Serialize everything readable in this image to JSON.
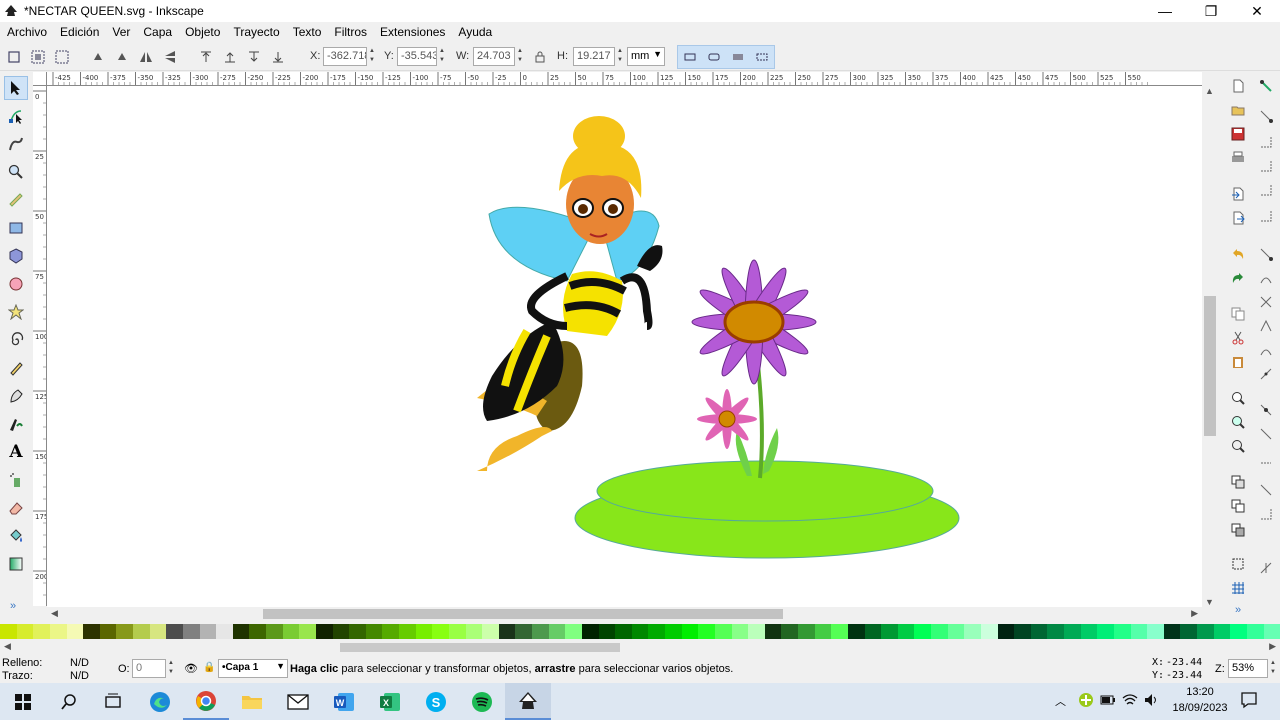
{
  "window": {
    "title": "*NECTAR QUEEN.svg - Inkscape"
  },
  "menu": [
    "Archivo",
    "Edición",
    "Ver",
    "Capa",
    "Objeto",
    "Trayecto",
    "Texto",
    "Filtros",
    "Extensiones",
    "Ayuda"
  ],
  "toolcontrols": {
    "x_label": "X:",
    "x_value": "-362.718",
    "y_label": "Y:",
    "y_value": "-35.543",
    "w_label": "W:",
    "w_value": "24.703",
    "h_label": "H:",
    "h_value": "19.217",
    "unit": "mm"
  },
  "ruler_top_ticks": [
    "-425",
    "-400",
    "-375",
    "-350",
    "-325",
    "-300",
    "-275",
    "-250",
    "-225",
    "-200",
    "-175",
    "-150",
    "-125",
    "-100",
    "-75",
    "-50",
    "-25",
    "0",
    "25",
    "50",
    "75",
    "100",
    "125",
    "150",
    "175",
    "200",
    "225",
    "250",
    "275",
    "300",
    "325",
    "350",
    "375",
    "400",
    "425",
    "450",
    "475",
    "500",
    "525",
    "550"
  ],
  "ruler_left_ticks": [
    "0",
    "25",
    "50",
    "75",
    "100",
    "125",
    "150",
    "175",
    "200"
  ],
  "status": {
    "fill_label": "Relleno:",
    "fill_value": "N/D",
    "stroke_label": "Trazo:",
    "stroke_value": "N/D",
    "opacity_label": "O:",
    "opacity_value": "0",
    "layer": "•Capa 1",
    "msg_bold1": "Haga clic",
    "msg1": " para seleccionar y transformar objetos, ",
    "msg_bold2": "arrastre",
    "msg2": " para seleccionar varios objetos.",
    "cursor_x_label": "X:",
    "cursor_x": "-23.44",
    "cursor_y_label": "Y:",
    "cursor_y": "-23.44",
    "zoom_label": "Z:",
    "zoom": "53%"
  },
  "taskbar": {
    "time": "13:20",
    "date": "18/09/2023"
  },
  "icons": {
    "tools": [
      "selector-icon",
      "node-icon",
      "tweak-icon",
      "zoom-icon",
      "measure-icon",
      "rect-icon",
      "3dbox-icon",
      "ellipse-icon",
      "star-icon",
      "spiral-icon",
      "pencil-icon",
      "pen-icon",
      "calligraphy-icon",
      "text-icon",
      "spray-icon",
      "eraser-icon",
      "bucket-icon",
      "gradient-icon"
    ]
  },
  "palette": [
    "#c9e600",
    "#d7ec2d",
    "#e1f15a",
    "#ebf687",
    "#f5fab4",
    "#2d3300",
    "#5a6600",
    "#87991a",
    "#b4cc4d",
    "#d7e680",
    "#4d4d4d",
    "#808080",
    "#b3b3b3",
    "#e6e6e6",
    "#1f3300",
    "#3d6600",
    "#5c991a",
    "#7acc33",
    "#99e64d",
    "#112200",
    "#224400",
    "#336600",
    "#448800",
    "#55aa00",
    "#66cc00",
    "#77ee00",
    "#88ff11",
    "#99ff44",
    "#aaff77",
    "#ccffaa",
    "#1a331a",
    "#336633",
    "#4d994d",
    "#66cc66",
    "#80ff80",
    "#002200",
    "#004400",
    "#006600",
    "#008800",
    "#00aa00",
    "#00cc00",
    "#00ee00",
    "#22ff22",
    "#55ff55",
    "#88ff88",
    "#bbffbb",
    "#113311",
    "#226622",
    "#339933",
    "#44cc44",
    "#55ff55",
    "#003311",
    "#006622",
    "#009933",
    "#00cc44",
    "#00ff55",
    "#33ff77",
    "#66ff99",
    "#99ffbb",
    "#ccffdd",
    "#002211",
    "#004422",
    "#006633",
    "#008844",
    "#00aa55",
    "#00cc66",
    "#00ee77",
    "#22ff88",
    "#55ffaa",
    "#88ffcc",
    "#00331a",
    "#006633",
    "#00994d",
    "#00cc66",
    "#00ff80",
    "#33ff99",
    "#66ffb3"
  ]
}
